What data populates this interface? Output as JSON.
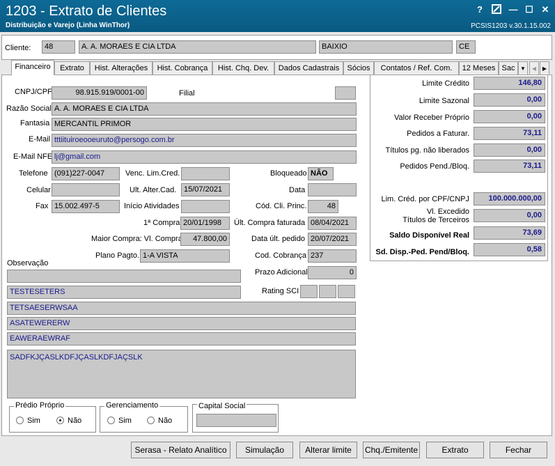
{
  "window": {
    "title": "1203 - Extrato de Clientes",
    "subtitle": "Distribuição e Varejo (Linha WinThor)",
    "version": "PCSIS1203  v.30.1.15.002",
    "help": "?",
    "minimize": "—",
    "maximize": "☐",
    "close": "✕"
  },
  "client": {
    "label": "Cliente:",
    "code": "48",
    "name": "A. A. MORAES E CIA LTDA",
    "district": "BAIXIO",
    "state": "CE"
  },
  "tabs": [
    "Financeiro",
    "Extrato",
    "Hist. Alterações",
    "Hist. Cobrança",
    "Hist. Chq. Dev.",
    "Dados Cadastrais",
    "Sócios",
    "Contatos / Ref. Com.",
    "12 Meses",
    "Sac"
  ],
  "form": {
    "cnpj_label": "CNPJ/CPF",
    "cnpj": "98.915.919/0001-00",
    "filial_label": "Filial",
    "filial": "",
    "razao_label": "Razão Social",
    "razao": "A. A. MORAES E CIA LTDA",
    "fantasia_label": "Fantasia",
    "fantasia": "MERCANTIL PRIMOR",
    "email_label": "E-Mail",
    "email": "tttiituiroeooeuruto@persogo.com.br",
    "email_nfe_label": "E-Mail NFE",
    "email_nfe": "lj@gmail.com",
    "telefone_label": "Telefone",
    "telefone": "(091)227-0047",
    "venc_label": "Venc. Lim.Cred.",
    "venc": "",
    "bloqueado_label": "Bloqueado",
    "bloqueado": "NÃO",
    "celular_label": "Celular",
    "celular": "",
    "ult_alter_label": "Ult. Alter.Cad.",
    "ult_alter": "15/07/2021",
    "data_label": "Data",
    "data": "",
    "fax_label": "Fax",
    "fax": "15.002.497-5",
    "inicio_label": "Início Atividades",
    "inicio": "",
    "cod_cli_label": "Cód. Cli. Princ.",
    "cod_cli": "48",
    "primeira_compra_label": "1ª Compra",
    "primeira_compra": "20/01/1998",
    "ult_compra_label": "Últ. Compra faturada",
    "ult_compra": "08/04/2021",
    "maior_compra_label": "Maior Compra: Vl. Compra",
    "maior_compra": "47.800,00",
    "data_ult_pedido_label": "Data últ. pedido",
    "data_ult_pedido": "20/07/2021",
    "plano_label": "Plano Pagto.",
    "plano": "1-A VISTA",
    "cod_cobranca_label": "Cod. Cobrança",
    "cod_cobranca": "237",
    "observacao_label": "Observação",
    "obs1": "",
    "obs2": "TESTESETERS",
    "obs3": "TETSAESERWSAA",
    "obs4": "ASATEWERERW",
    "obs5": "EAWERAEWRAF",
    "obs_memo": "SADFKJÇASLKDFJÇASLKDFJAÇSLK",
    "prazo_label": "Prazo Adicional",
    "prazo": "0",
    "rating_label": "Rating SCI"
  },
  "right": {
    "limite_credito_label": "Limite Crédito",
    "limite_credito": "146,80",
    "limite_sazonal_label": "Limite Sazonal",
    "limite_sazonal": "0,00",
    "valor_receber_label": "Valor Receber Próprio",
    "valor_receber": "0,00",
    "pedidos_faturar_label": "Pedidos a Faturar.",
    "pedidos_faturar": "73,11",
    "titulos_label": "Títulos pg. não liberados",
    "titulos": "0,00",
    "pedidos_pend_label": "Pedidos Pend./Bloq.",
    "pedidos_pend": "73,11",
    "lim_cpf_label": "Lim. Créd. por CPF/CNPJ",
    "lim_cpf": "100.000.000,00",
    "vl_excedido_label1": "Vl. Excedido",
    "vl_excedido_label2": "Títulos de Terceiros",
    "vl_excedido": "0,00",
    "saldo_label": "Saldo Disponível Real",
    "saldo": "73,69",
    "sd_disp_label": "Sd. Disp.-Ped. Pend/Bloq.",
    "sd_disp": "0,58"
  },
  "groups": {
    "predio_title": "Prédio Próprio",
    "gerenciamento_title": "Gerenciamento",
    "capital_title": "Capital Social",
    "sim": "Sim",
    "nao": "Não",
    "capital": ""
  },
  "buttons": {
    "serasa": "Serasa - Relato Analítico",
    "simulacao": "Simulação",
    "alterar": "Alterar limite",
    "chq": "Chq./Emitente",
    "extrato": "Extrato",
    "fechar": "Fechar"
  }
}
